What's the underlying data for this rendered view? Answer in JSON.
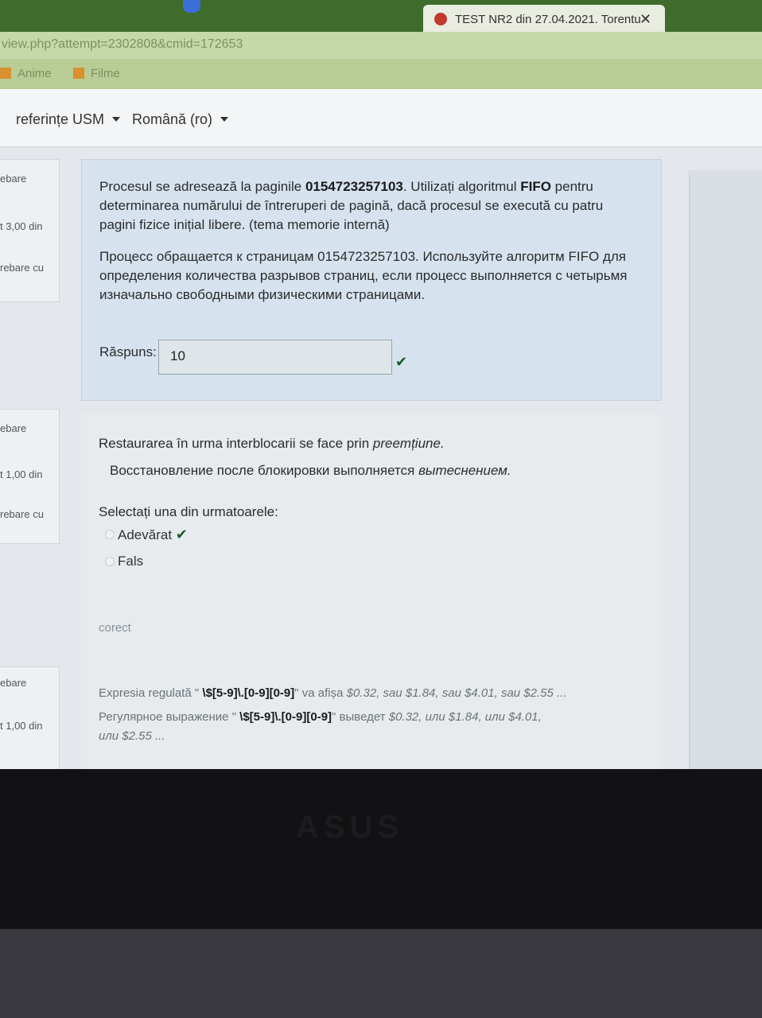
{
  "browser": {
    "tab_title": "TEST NR2 din 27.04.2021. Torentu",
    "tab_close": "✕",
    "url": "view.php?attempt=2302808&cmid=172653",
    "bookmarks": [
      "Anime",
      "Filme"
    ]
  },
  "nav": {
    "item1": "referințe USM",
    "item2": "Română (ro)"
  },
  "sidebar_info": [
    {
      "lines": [
        "ebare",
        "t 3,00 din",
        "rebare cu"
      ]
    },
    {
      "lines": [
        "ebare",
        "t 1,00 din",
        "rebare cu"
      ]
    },
    {
      "lines": [
        "ebare",
        "t 1,00 din"
      ]
    }
  ],
  "question1": {
    "ro_part1": "Procesul se adresează la paginile ",
    "ro_pages": "0154723257103",
    "ro_part2": ". Utilizați algoritmul ",
    "ro_algo": "FIFO",
    "ro_part3": " pentru",
    "ro_line2": "determinarea numărului de întreruperi de pagină, dacă procesul se execută cu patru",
    "ro_line3": "pagini fizice inițial libere.   (tema memorie internă)",
    "ru_line1": "Процесс обращается к страницам 0154723257103. Используйте алгоритм FIFO для",
    "ru_line2": "определения количества разрывов страниц, если процесс выполняется с четырьмя",
    "ru_line3": "изначально свободными физическими страницами.",
    "answer_label": "Răspuns:",
    "answer_value": "10",
    "check": "✔"
  },
  "question2": {
    "ro_text": "Restaurarea în urma interblocarii se face prin ",
    "ro_italic": "preemțiune.",
    "ru_text": "Восстановление после блокировки выполняется ",
    "ru_italic": "вытеснением.",
    "prompt": "Selectați una din urmatoarele:",
    "option_true": "Adevărat",
    "option_false": "Fals",
    "check": "✔",
    "feedback": "corect"
  },
  "question3": {
    "ro_text_a": "Expresia regulată \" ",
    "ro_regex": "\\$[5-9]\\.[0-9][0-9]",
    "ro_text_b": "\" va afișa ",
    "ro_vals": "$0.32, sau $1.84, sau $4.01, sau $2.55 ...",
    "ru_text_a": "Регулярное выражение \" ",
    "ru_regex": "\\$[5-9]\\.[0-9][0-9]",
    "ru_text_b": "\" выведет ",
    "ru_vals": "$0.32, или $1.84, или $4.01,",
    "ru_vals2": "или $2.55 ..."
  },
  "laptop": {
    "brand": "ASUS"
  },
  "colors": {
    "tabbar": "#3f6b2c",
    "question_bg": "#d6e3ef",
    "check": "#1d5b2a"
  }
}
